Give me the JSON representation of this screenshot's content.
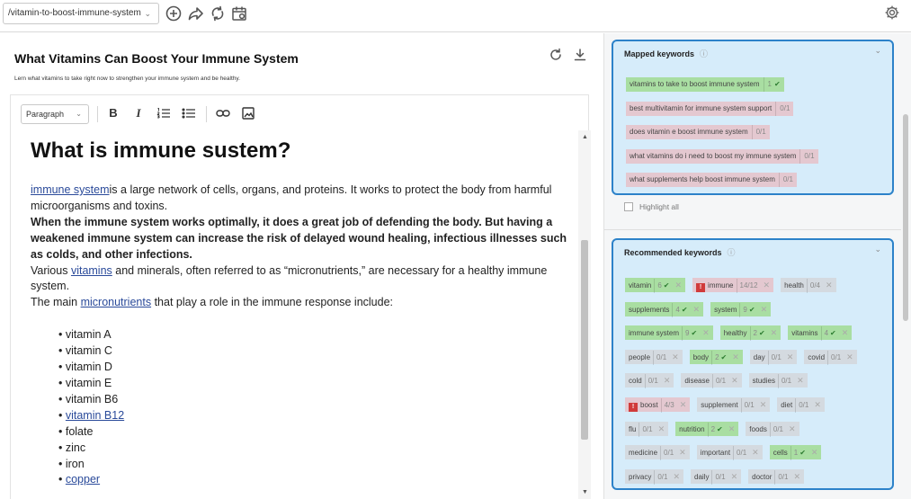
{
  "toolbar": {
    "url_select_value": "/vitamin-to-boost-immune-system",
    "icons": [
      "add-circle-icon",
      "share-icon",
      "sync-icon",
      "calendar-icon",
      "gear-icon"
    ]
  },
  "document": {
    "title": "What Vitamins Can Boost Your Immune System",
    "subtitle": "Lern what vitamins to take right now to strengthen your immune system and be healthy."
  },
  "format_bar": {
    "block_type": "Paragraph",
    "bold_label": "B",
    "italic_label": "I"
  },
  "content": {
    "heading": "What is immune sustem?",
    "p1_link": "immune system",
    "p1_text": "is a large network of cells, organs, and proteins. It works to protect the body from harmful microorganisms and toxins.",
    "p2_bold": "When the immune system works optimally, it does a great job of defending the body. But having a weakened immune system can increase the risk of delayed wound healing, infectious illnesses such as colds, and other infections.",
    "p3_pre": "Various ",
    "p3_link": "vitamins",
    "p3_post": " and minerals, often referred to as “micronutrients,” are necessary for a healthy immune system.",
    "p4_pre": "The main ",
    "p4_link": "micronutrients",
    "p4_post": " that play a role in the immune response include:",
    "list": [
      {
        "text": "vitamin A",
        "link": false
      },
      {
        "text": "vitamin C",
        "link": false
      },
      {
        "text": "vitamin D",
        "link": false
      },
      {
        "text": "vitamin E",
        "link": false
      },
      {
        "text": "vitamin B6",
        "link": false
      },
      {
        "text": "vitamin B12",
        "link": true
      },
      {
        "text": "folate",
        "link": false
      },
      {
        "text": "zinc",
        "link": false
      },
      {
        "text": "iron",
        "link": false
      },
      {
        "text": "copper",
        "link": true
      }
    ]
  },
  "mapped": {
    "title": "Mapped keywords",
    "info_icon": "info-icon",
    "items": [
      {
        "text": "vitamins to take to boost immune system",
        "count": "1",
        "status": "good"
      },
      {
        "text": "best multivitamin for immune system support",
        "count": "0/1",
        "status": "missing"
      },
      {
        "text": "does vitamin e boost immune system",
        "count": "0/1",
        "status": "missing"
      },
      {
        "text": "what vitamins do i need to boost my immune system",
        "count": "0/1",
        "status": "missing"
      },
      {
        "text": "what supplements help boost immune system",
        "count": "0/1",
        "status": "missing"
      }
    ],
    "highlight_all_label": "Highlight all"
  },
  "recommended": {
    "title": "Recommended keywords",
    "rows": [
      [
        {
          "text": "vitamin",
          "count": "6",
          "status": "good",
          "check": true
        },
        {
          "text": "immune",
          "count": "14/12",
          "status": "over",
          "warn": true
        },
        {
          "text": "health",
          "count": "0/4",
          "status": "neutral"
        }
      ],
      [
        {
          "text": "supplements",
          "count": "4",
          "status": "good",
          "check": true
        },
        {
          "text": "system",
          "count": "9",
          "status": "good",
          "check": true
        }
      ],
      [
        {
          "text": "immune system",
          "count": "9",
          "status": "good",
          "check": true
        },
        {
          "text": "healthy",
          "count": "2",
          "status": "good",
          "check": true
        },
        {
          "text": "vitamins",
          "count": "4",
          "status": "good",
          "check": true
        }
      ],
      [
        {
          "text": "people",
          "count": "0/1",
          "status": "neutral"
        },
        {
          "text": "body",
          "count": "2",
          "status": "good",
          "check": true
        },
        {
          "text": "day",
          "count": "0/1",
          "status": "neutral"
        },
        {
          "text": "covid",
          "count": "0/1",
          "status": "neutral"
        }
      ],
      [
        {
          "text": "cold",
          "count": "0/1",
          "status": "neutral"
        },
        {
          "text": "disease",
          "count": "0/1",
          "status": "neutral"
        },
        {
          "text": "studies",
          "count": "0/1",
          "status": "neutral"
        }
      ],
      [
        {
          "text": "boost",
          "count": "4/3",
          "status": "over",
          "warn": true
        },
        {
          "text": "supplement",
          "count": "0/1",
          "status": "neutral"
        },
        {
          "text": "diet",
          "count": "0/1",
          "status": "neutral"
        }
      ],
      [
        {
          "text": "flu",
          "count": "0/1",
          "status": "neutral"
        },
        {
          "text": "nutrition",
          "count": "2",
          "status": "good",
          "check": true
        },
        {
          "text": "foods",
          "count": "0/1",
          "status": "neutral"
        }
      ],
      [
        {
          "text": "medicine",
          "count": "0/1",
          "status": "neutral"
        },
        {
          "text": "important",
          "count": "0/1",
          "status": "neutral"
        },
        {
          "text": "cells",
          "count": "1",
          "status": "good",
          "check": true
        }
      ],
      [
        {
          "text": "privacy",
          "count": "0/1",
          "status": "neutral"
        },
        {
          "text": "daily",
          "count": "0/1",
          "status": "neutral"
        },
        {
          "text": "doctor",
          "count": "0/1",
          "status": "neutral"
        }
      ]
    ]
  },
  "colors": {
    "accent": "#2c82c9",
    "card_bg": "#d6ecfa",
    "good": "#a9dea2",
    "neutral": "#d4dae0",
    "missing": "#e4c8d0",
    "warn": "#d03b3b"
  }
}
